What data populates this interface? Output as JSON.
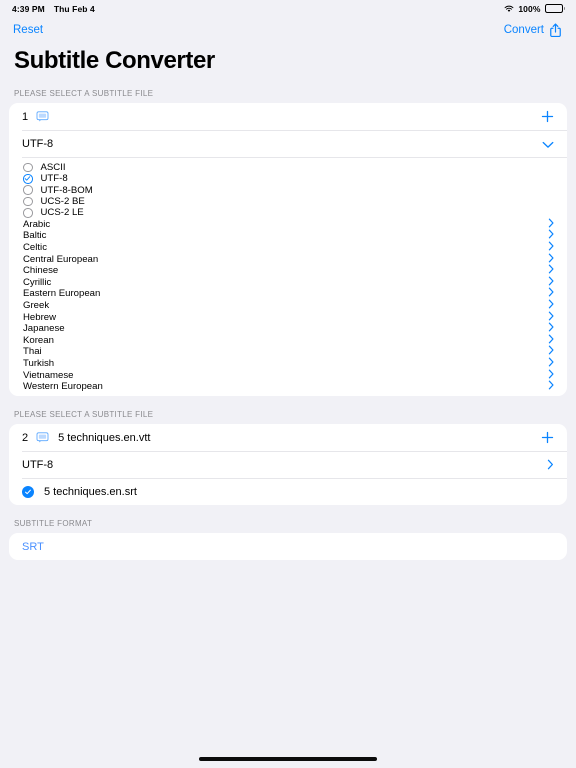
{
  "status_bar": {
    "time": "4:39 PM",
    "date": "Thu Feb 4",
    "wifi_icon": "wifi-icon",
    "battery_percent": "100%",
    "battery_icon": "battery-icon"
  },
  "nav": {
    "reset_label": "Reset",
    "convert_label": "Convert",
    "convert_icon": "share-export-icon"
  },
  "page_title": "Subtitle Converter",
  "accent_color": "#0A84FF",
  "background_color": "#F1F1F6",
  "card_color": "#FFFFFF",
  "sections": {
    "first": {
      "header": "PLEASE SELECT A SUBTITLE FILE",
      "file_row": {
        "index": "1",
        "captions_icon": "captions-icon",
        "filename": "",
        "add_icon": "plus-icon"
      },
      "encoding_row": {
        "value": "UTF-8",
        "disclosure_icon": "chevron-down-icon"
      },
      "picker": {
        "encodings": [
          {
            "label": "ASCII",
            "selected": false
          },
          {
            "label": "UTF-8",
            "selected": true
          },
          {
            "label": "UTF-8-BOM",
            "selected": false
          },
          {
            "label": "UCS-2 BE",
            "selected": false
          },
          {
            "label": "UCS-2 LE",
            "selected": false
          }
        ],
        "languages": [
          "Arabic",
          "Baltic",
          "Celtic",
          "Central European",
          "Chinese",
          "Cyrillic",
          "Eastern European",
          "Greek",
          "Hebrew",
          "Japanese",
          "Korean",
          "Thai",
          "Turkish",
          "Vietnamese",
          "Western European"
        ],
        "language_disclosure_icon": "chevron-right-icon"
      }
    },
    "second": {
      "header": "PLEASE SELECT A SUBTITLE FILE",
      "file_row": {
        "index": "2",
        "captions_icon": "captions-icon",
        "filename": "5 techniques.en.vtt",
        "add_icon": "plus-icon"
      },
      "encoding_row": {
        "value": "UTF-8",
        "disclosure_icon": "chevron-right-icon"
      },
      "output_row": {
        "check_icon": "checkmark-circle-filled-icon",
        "filename": "5 techniques.en.srt"
      }
    },
    "format": {
      "header": "SUBTITLE FORMAT",
      "value": "SRT"
    }
  },
  "home_indicator": "home-indicator"
}
